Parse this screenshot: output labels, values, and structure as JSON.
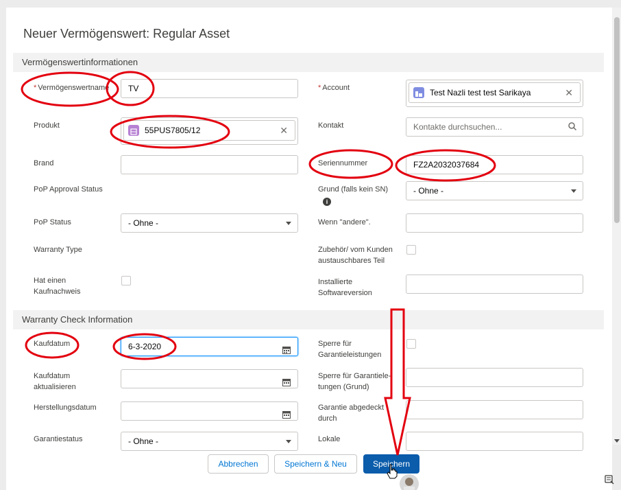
{
  "modal": {
    "title": "Neuer Vermögenswert: Regular Asset"
  },
  "sections": {
    "info": "Vermögenswertinformationen",
    "warranty": "Warranty Check Information"
  },
  "fields": {
    "asset_name": {
      "label": "Vermögenswertname",
      "required_mark": "*",
      "value": "TV"
    },
    "account": {
      "label": "Account",
      "required_mark": "*",
      "value": "Test Nazli test test Sarikaya"
    },
    "product": {
      "label": "Produkt",
      "value": "55PUS7805/12"
    },
    "contact": {
      "label": "Kontakt",
      "placeholder": "Kontakte durchsuchen..."
    },
    "brand": {
      "label": "Brand",
      "value": ""
    },
    "serial": {
      "label": "Seriennummer",
      "value": "FZ2A2032037684"
    },
    "pop_approval": {
      "label": "PoP Approval Status"
    },
    "reason_no_sn": {
      "label": "Grund (falls kein SN)",
      "value": "- Ohne -"
    },
    "pop_status": {
      "label": "PoP Status",
      "value": "- Ohne -"
    },
    "if_other": {
      "label": "Wenn \"andere\".",
      "value": ""
    },
    "warranty_type": {
      "label": "Warranty Type"
    },
    "accessory": {
      "label_1": "Zubehör/ vom Kunden",
      "label_2": "austauschbares Teil"
    },
    "proof_of_purchase": {
      "label_1": "Hat einen",
      "label_2": "Kaufnachweis"
    },
    "installed_sw": {
      "label_1": "Installierte",
      "label_2": "Softwareversion",
      "value": ""
    },
    "purchase_date": {
      "label": "Kaufdatum",
      "value": "6-3-2020"
    },
    "warranty_block": {
      "label_1": "Sperre für",
      "label_2": "Garantieleistungen"
    },
    "purchase_date_update": {
      "label_1": "Kaufdatum",
      "label_2": "aktualisieren",
      "value": ""
    },
    "warranty_block_reason": {
      "label_1": "Sperre für Garantiele-",
      "label_2": "tungen (Grund)",
      "value": ""
    },
    "manufacture_date": {
      "label": "Herstellungsdatum",
      "value": ""
    },
    "warranty_covered": {
      "label_1": "Garantie abgedeckt",
      "label_2": "durch",
      "value": ""
    },
    "warranty_status": {
      "label": "Garantiestatus",
      "value": "- Ohne -"
    },
    "local": {
      "label": "Lokale",
      "value": ""
    }
  },
  "footer": {
    "cancel": "Abbrechen",
    "save_new": "Speichern & Neu",
    "save": "Speichern"
  },
  "icons": {
    "info": "i",
    "close": "✕"
  },
  "colors": {
    "brand_button": "#0b5cab",
    "annotation": "#e3000f",
    "account_icon": "#7f8de1",
    "product_icon": "#b781d3"
  }
}
